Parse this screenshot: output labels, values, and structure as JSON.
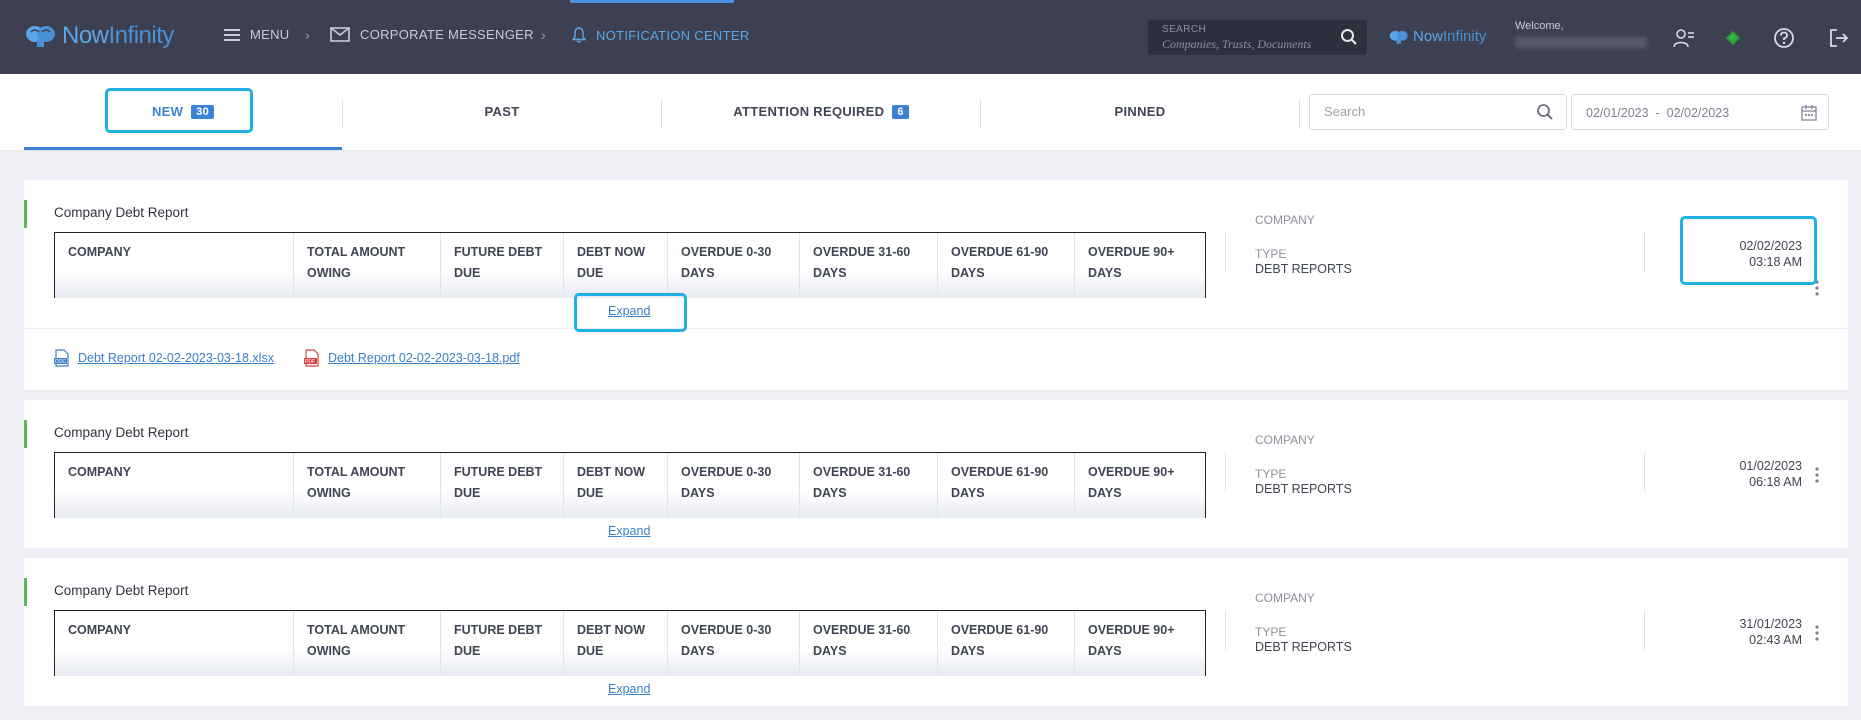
{
  "header": {
    "logo": "NowInfinity",
    "menu_label": "MENU",
    "nav": [
      {
        "label": "CORPORATE MESSENGER"
      },
      {
        "label": "NOTIFICATION CENTER"
      }
    ],
    "search": {
      "label": "SEARCH",
      "placeholder": "Companies, Trusts, Documents"
    },
    "brand_small": "NowInfinity",
    "welcome_label": "Welcome,"
  },
  "tabs": [
    {
      "label": "NEW",
      "count": "30"
    },
    {
      "label": "PAST"
    },
    {
      "label": "ATTENTION REQUIRED",
      "count": "6"
    },
    {
      "label": "PINNED"
    }
  ],
  "filter": {
    "search_placeholder": "Search",
    "date_from": "02/01/2023",
    "date_sep": "-",
    "date_to": "02/02/2023"
  },
  "columns": [
    {
      "line1": "COMPANY",
      "line2": ""
    },
    {
      "line1": "TOTAL AMOUNT",
      "line2": "OWING"
    },
    {
      "line1": "FUTURE DEBT",
      "line2": "DUE"
    },
    {
      "line1": "DEBT NOW",
      "line2": "DUE"
    },
    {
      "line1": "OVERDUE 0-30",
      "line2": "DAYS"
    },
    {
      "line1": "OVERDUE 31-60",
      "line2": "DAYS"
    },
    {
      "line1": "OVERDUE 61-90",
      "line2": "DAYS"
    },
    {
      "line1": "OVERDUE 90+",
      "line2": "DAYS"
    }
  ],
  "notifications": [
    {
      "title": "Company Debt Report",
      "expand_label": "Expand",
      "company_label": "COMPANY",
      "type_label": "TYPE",
      "type_value": "DEBT REPORTS",
      "date": "02/02/2023",
      "time": "03:18 AM",
      "attachments": [
        {
          "name": "Debt Report 02-02-2023-03-18.xlsx",
          "icon": "xlsx-file-icon"
        },
        {
          "name": "Debt Report 02-02-2023-03-18.pdf",
          "icon": "pdf-file-icon"
        }
      ]
    },
    {
      "title": "Company Debt Report",
      "expand_label": "Expand",
      "company_label": "COMPANY",
      "type_label": "TYPE",
      "type_value": "DEBT REPORTS",
      "date": "01/02/2023",
      "time": "06:18 AM"
    },
    {
      "title": "Company Debt Report",
      "expand_label": "Expand",
      "company_label": "COMPANY",
      "type_label": "TYPE",
      "type_value": "DEBT REPORTS",
      "date": "31/01/2023",
      "time": "02:43 AM"
    }
  ],
  "colors": {
    "topbar": "#3c4050",
    "accent": "#3b82d6",
    "card_accent": "#5cb85c",
    "highlight": "#1fb0e6"
  }
}
